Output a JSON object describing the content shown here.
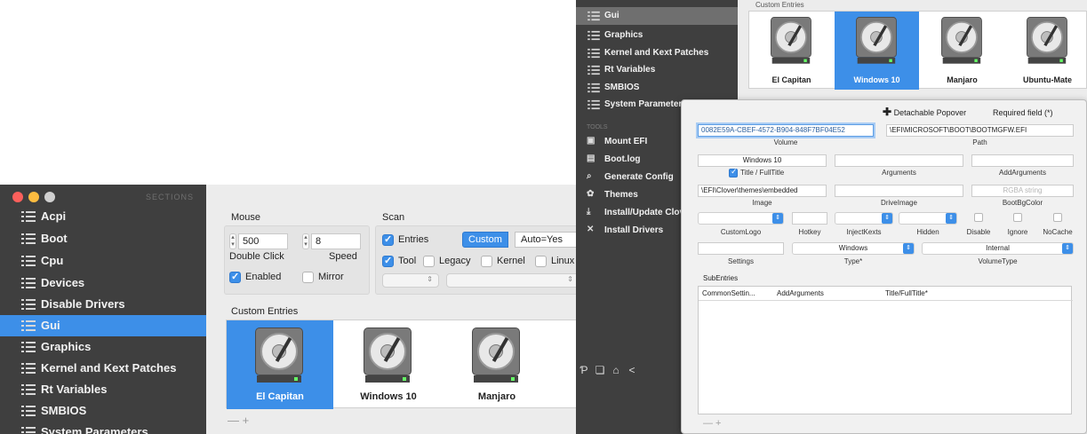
{
  "left": {
    "sidebar": {
      "title": "SECTIONS",
      "items": [
        "Acpi",
        "Boot",
        "Cpu",
        "Devices",
        "Disable Drivers",
        "Gui",
        "Graphics",
        "Kernel and Kext Patches",
        "Rt Variables",
        "SMBIOS",
        "System Parameters"
      ],
      "selected": "Gui"
    },
    "mouse": {
      "label": "Mouse",
      "double_click_value": "500",
      "double_click_label": "Double Click",
      "speed_value": "8",
      "speed_label": "Speed",
      "enabled_label": "Enabled",
      "enabled_checked": true,
      "mirror_label": "Mirror",
      "mirror_checked": false
    },
    "scan": {
      "label": "Scan",
      "entries_label": "Entries",
      "entries_checked": true,
      "custom_label": "Custom",
      "auto_label": "Auto=Yes",
      "tool_label": "Tool",
      "tool_checked": true,
      "legacy_label": "Legacy",
      "kernel_label": "Kernel",
      "linux_label": "Linux"
    },
    "custom_entries": {
      "label": "Custom Entries",
      "items": [
        "El Capitan",
        "Windows 10",
        "Manjaro"
      ],
      "selected": "El Capitan"
    },
    "add_remove": "— +"
  },
  "right": {
    "sidebar": {
      "items": [
        "Gui",
        "Graphics",
        "Kernel and Kext Patches",
        "Rt Variables",
        "SMBIOS",
        "System Parameters"
      ],
      "tools_label": "TOOLS",
      "tools": [
        "Mount EFI",
        "Boot.log",
        "Generate Config",
        "Themes",
        "Install/Update Clover",
        "Install Drivers"
      ],
      "bottom_icons": [
        "paypal-icon",
        "bookmark-icon",
        "home-icon",
        "share-icon"
      ]
    },
    "custom_entries": {
      "label": "Custom Entries",
      "items": [
        "El Capitan",
        "Windows 10",
        "Manjaro",
        "Ubuntu-Mate"
      ],
      "selected": "Windows 10"
    },
    "popover": {
      "detachable_label": "Detachable Popover",
      "required_label": "Required field (*)",
      "volume_value": "0082E59A-CBEF-4572-B904-848F7BF04E52",
      "volume_label": "Volume",
      "path_value": "\\EFI\\MICROSOFT\\BOOT\\BOOTMGFW.EFI",
      "path_label": "Path",
      "title_value": "Windows 10",
      "title_label": "Title / FullTitle",
      "title_checked": true,
      "arguments_label": "Arguments",
      "add_arguments_label": "AddArguments",
      "image_value": "\\EFI\\Clover\\themes\\embedded",
      "image_label": "Image",
      "drive_image_label": "DriveImage",
      "boot_bg_placeholder": "RGBA string",
      "boot_bg_label": "BootBgColor",
      "custom_logo_label": "CustomLogo",
      "hotkey_label": "Hotkey",
      "inject_kexts_label": "InjectKexts",
      "hidden_label": "Hidden",
      "disable_label": "Disable",
      "ignore_label": "Ignore",
      "nocache_label": "NoCache",
      "settings_label": "Settings",
      "type_value": "Windows",
      "type_label": "Type*",
      "volume_type_value": "Internal",
      "volume_type_label": "VolumeType",
      "subentries_label": "SubEntries",
      "subentries_columns": [
        "CommonSettin...",
        "AddArguments",
        "Title/FullTitle*"
      ],
      "add_remove": "— +"
    }
  },
  "colors": {
    "accent": "#3d8fe8",
    "sidebar": "#3f3f3f",
    "close": "#fc605c",
    "minimize": "#fdbc40",
    "zoom": "#d0d0d0"
  }
}
